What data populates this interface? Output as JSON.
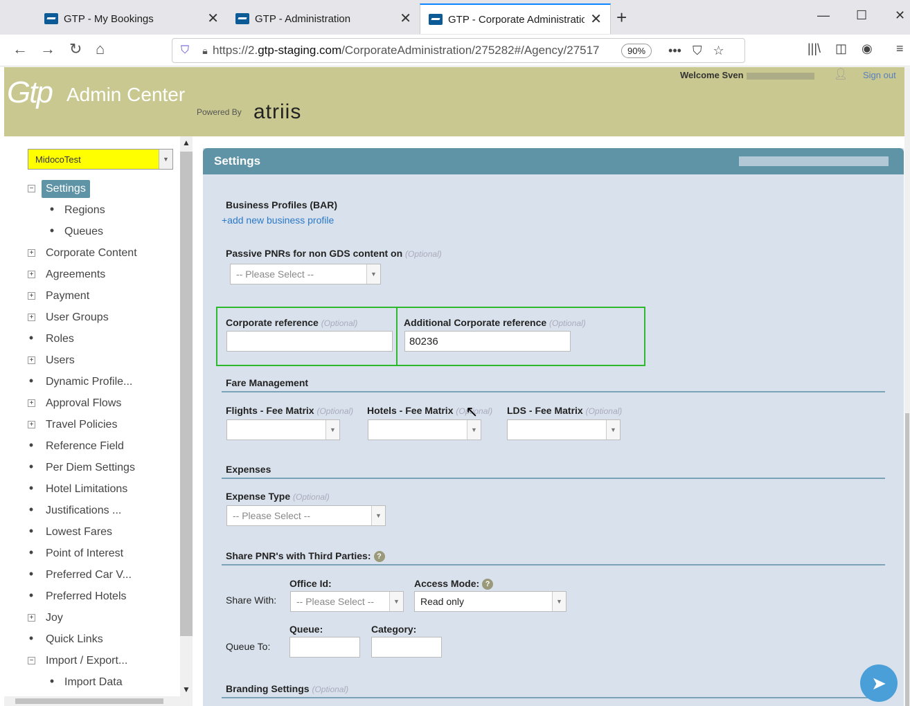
{
  "browser": {
    "tabs": [
      {
        "title": "GTP - My Bookings"
      },
      {
        "title": "GTP - Administration"
      },
      {
        "title": "GTP - Corporate Administration"
      }
    ],
    "url_prefix": "https://2.",
    "url_domain": "gtp-staging.com",
    "url_path": "/CorporateAdministration/275282#/Agency/27517",
    "zoom": "90%"
  },
  "header": {
    "logo": "Gtp",
    "app_name": "Admin Center",
    "powered_by": "Powered By",
    "brand": "atriis",
    "welcome": "Welcome Sven",
    "sign_out": "Sign out"
  },
  "sidebar": {
    "client_select": "MidocoTest",
    "items": [
      {
        "label": "Settings",
        "marker": "minus",
        "level": 0,
        "active": true
      },
      {
        "label": "Regions",
        "marker": "dot",
        "level": 1
      },
      {
        "label": "Queues",
        "marker": "dot",
        "level": 1
      },
      {
        "label": "Corporate Content",
        "marker": "plus",
        "level": 0
      },
      {
        "label": "Agreements",
        "marker": "plus",
        "level": 0
      },
      {
        "label": "Payment",
        "marker": "plus",
        "level": 0
      },
      {
        "label": "User Groups",
        "marker": "plus",
        "level": 0
      },
      {
        "label": "Roles",
        "marker": "dot",
        "level": 0
      },
      {
        "label": "Users",
        "marker": "plus",
        "level": 0
      },
      {
        "label": "Dynamic Profile...",
        "marker": "dot",
        "level": 0
      },
      {
        "label": "Approval Flows",
        "marker": "plus",
        "level": 0
      },
      {
        "label": "Travel Policies",
        "marker": "plus",
        "level": 0
      },
      {
        "label": "Reference Field",
        "marker": "dot",
        "level": 0
      },
      {
        "label": "Per Diem Settings",
        "marker": "dot",
        "level": 0
      },
      {
        "label": "Hotel Limitations",
        "marker": "dot",
        "level": 0
      },
      {
        "label": "Justifications ...",
        "marker": "dot",
        "level": 0
      },
      {
        "label": "Lowest Fares",
        "marker": "dot",
        "level": 0
      },
      {
        "label": "Point of Interest",
        "marker": "dot",
        "level": 0
      },
      {
        "label": "Preferred Car V...",
        "marker": "dot",
        "level": 0
      },
      {
        "label": "Preferred Hotels",
        "marker": "dot",
        "level": 0
      },
      {
        "label": "Joy",
        "marker": "plus",
        "level": 0
      },
      {
        "label": "Quick Links",
        "marker": "dot",
        "level": 0
      },
      {
        "label": "Import / Export...",
        "marker": "minus",
        "level": 0
      },
      {
        "label": "Import Data",
        "marker": "dot",
        "level": 1
      }
    ]
  },
  "main": {
    "panel_title": "Settings",
    "optional": "(Optional)",
    "bar_label": "Business Profiles (BAR)",
    "add_profile": "+add new business profile",
    "passive_label": "Passive PNRs for non GDS content on",
    "please_select": "-- Please Select --",
    "corp_ref_label": "Corporate reference",
    "corp_ref_value": "",
    "add_corp_ref_label": "Additional Corporate reference",
    "add_corp_ref_value": "80236",
    "fare_mgmt": "Fare Management",
    "flights_fee": "Flights - Fee Matrix",
    "hotels_fee": "Hotels - Fee Matrix",
    "lds_fee": "LDS - Fee Matrix",
    "expenses": "Expenses",
    "expense_type": "Expense Type",
    "share_pnr": "Share PNR's with Third Parties:",
    "office_id": "Office Id:",
    "access_mode": "Access Mode:",
    "share_with": "Share With:",
    "access_value": "Read only",
    "queue": "Queue:",
    "category": "Category:",
    "queue_to": "Queue To:",
    "branding": "Branding Settings"
  }
}
